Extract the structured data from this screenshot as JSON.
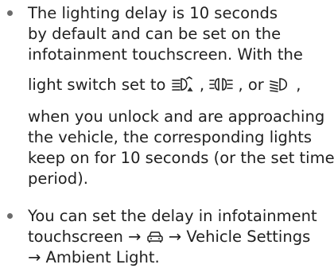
{
  "items": [
    {
      "lines": [
        "The lighting delay is 10 seconds",
        "by default and can be set on the",
        "infotainment touchscreen. With the",
        null,
        "when you unlock and are approaching",
        "the vehicle, the corresponding lights",
        "keep on for 10 seconds (or the set time",
        "period)."
      ],
      "switch_line": {
        "prefix": "light switch set to ",
        "sep1": " , ",
        "sep2": " , or ",
        "suffix": " ,",
        "icons": [
          "auto-headlight-icon",
          "side-light-icon",
          "low-beam-icon"
        ]
      }
    },
    {
      "lines": [
        "You can set the delay in infotainment",
        null,
        "→ Ambient Light."
      ],
      "path_line": {
        "prefix": "touchscreen → ",
        "suffix": " → Vehicle Settings",
        "icon": "car-icon"
      }
    }
  ]
}
